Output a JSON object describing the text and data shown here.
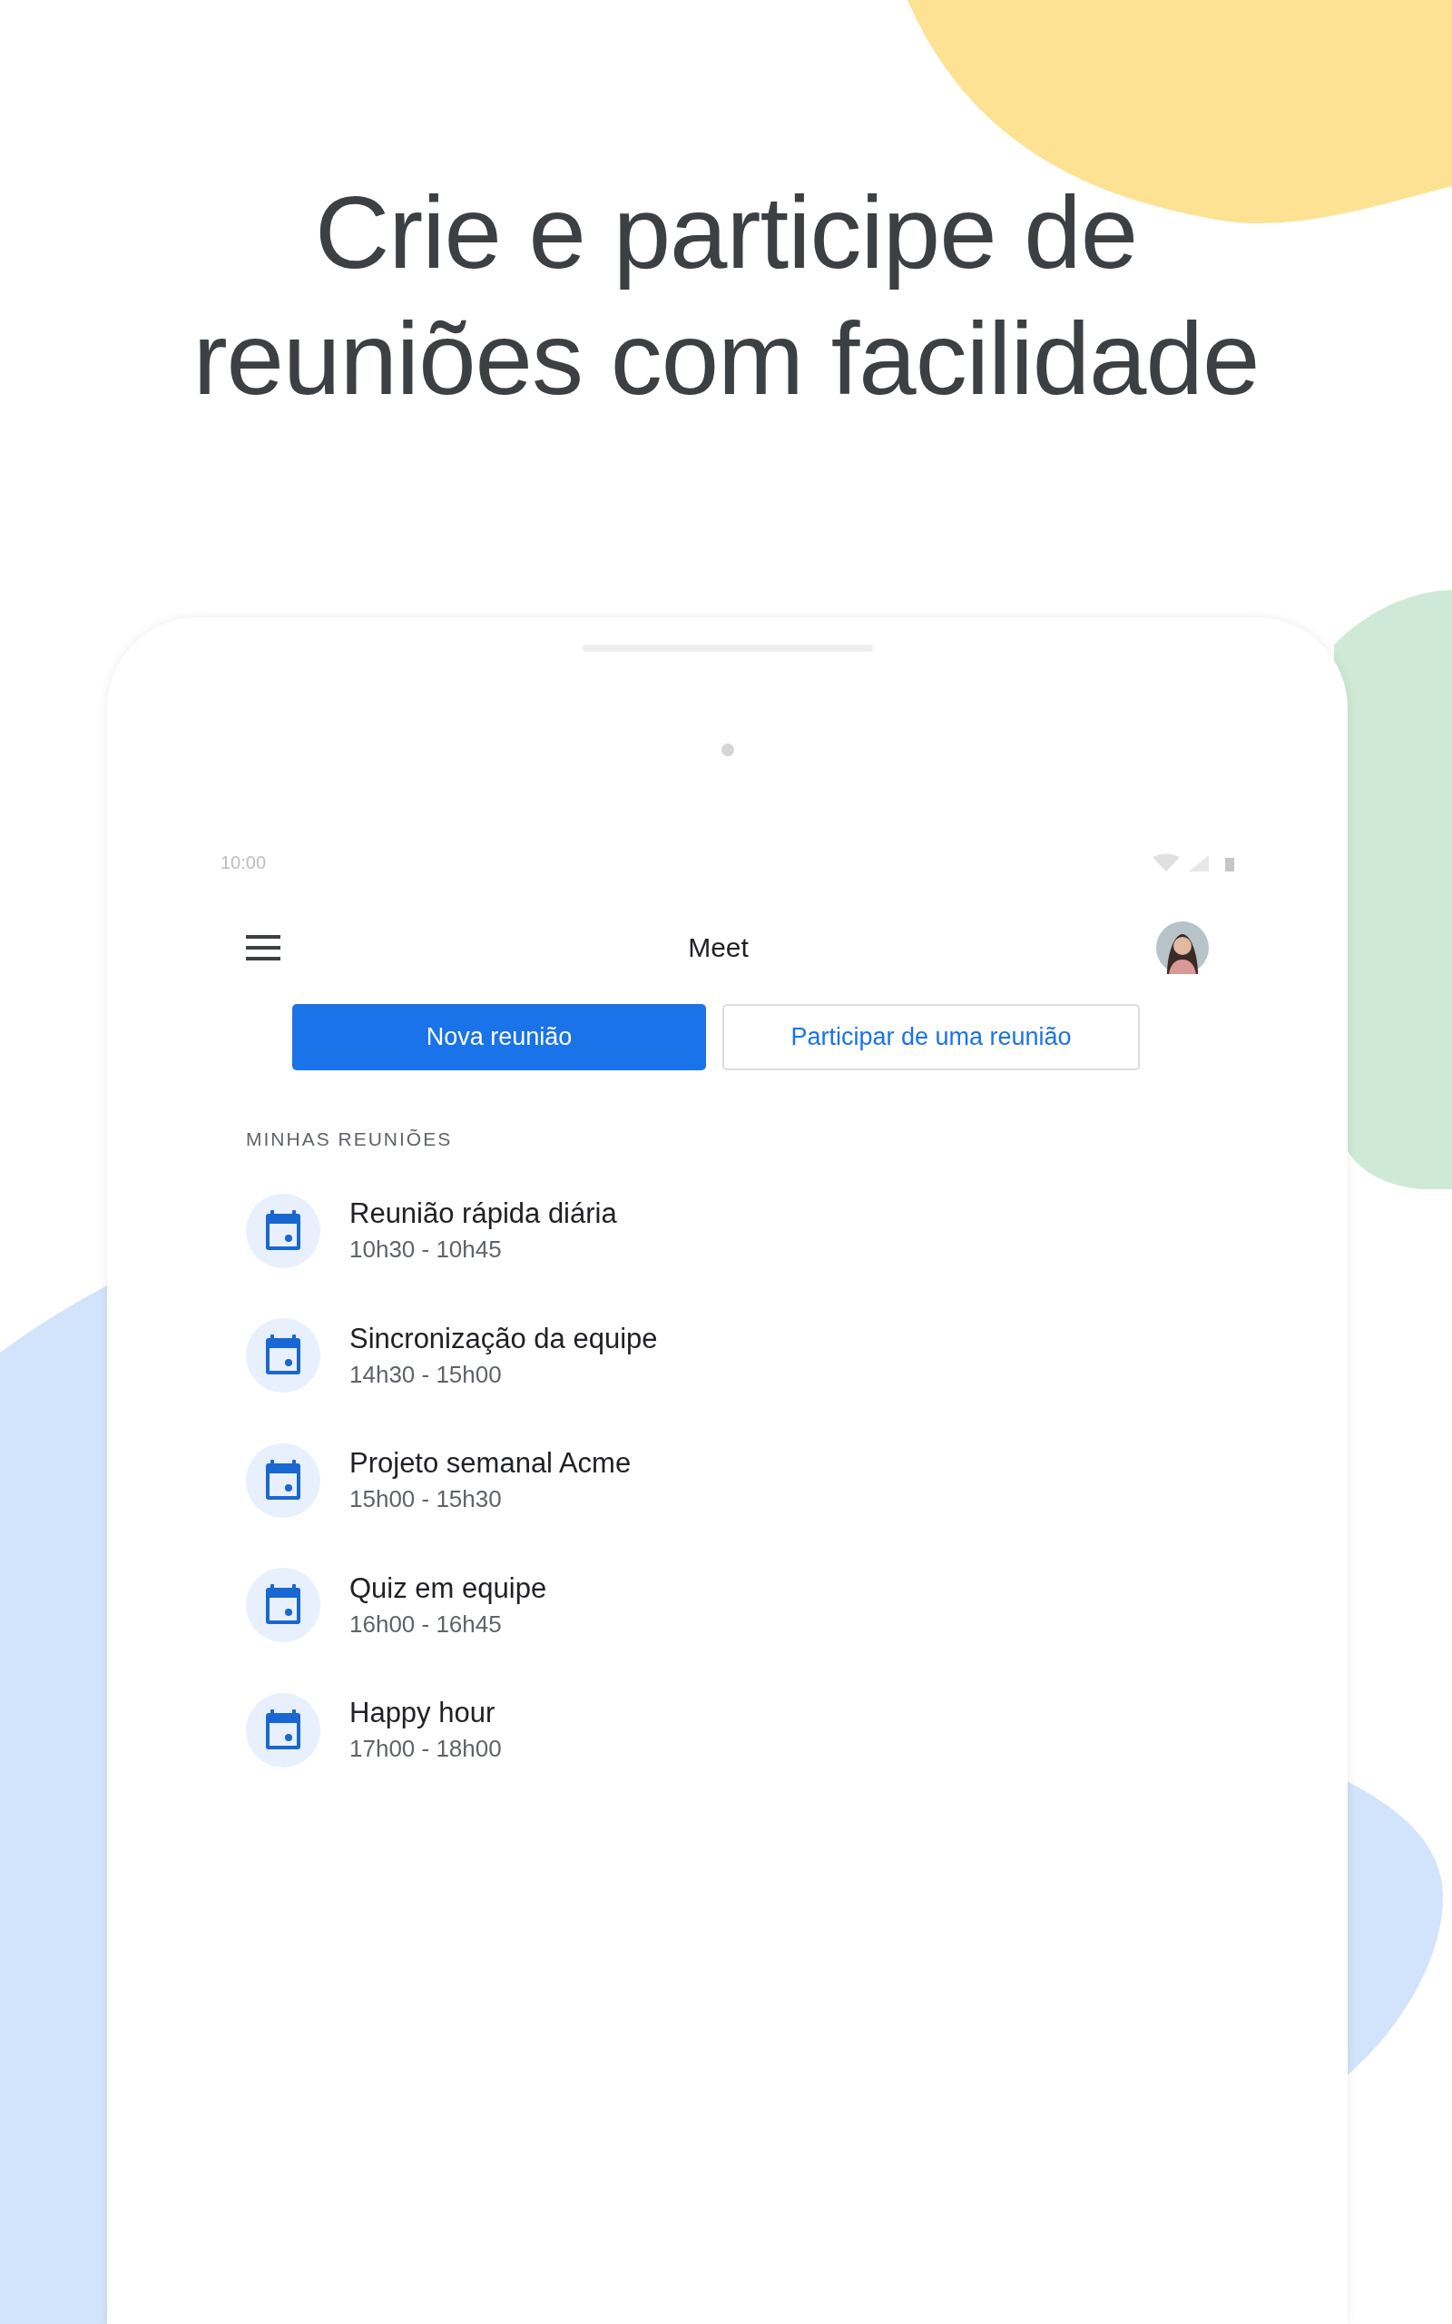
{
  "headline_lines": [
    "Crie e participe de",
    "reuniões com facilidade"
  ],
  "status_bar": {
    "time": "10:00"
  },
  "app_bar": {
    "title": "Meet"
  },
  "buttons": [
    {
      "label": "Nova reunião",
      "kind": "primary"
    },
    {
      "label": "Participar de uma reunião",
      "kind": "outlined"
    }
  ],
  "section_title": "MINHAS REUNIÕES",
  "meetings": [
    {
      "title": "Reunião rápida diária",
      "time": "10h30 - 10h45"
    },
    {
      "title": "Sincronização da equipe",
      "time": "14h30 - 15h00"
    },
    {
      "title": "Projeto semanal Acme",
      "time": "15h00 - 15h30"
    },
    {
      "title": "Quiz em equipe",
      "time": "16h00 - 16h45"
    },
    {
      "title": "Happy hour",
      "time": "17h00 - 18h00"
    }
  ]
}
